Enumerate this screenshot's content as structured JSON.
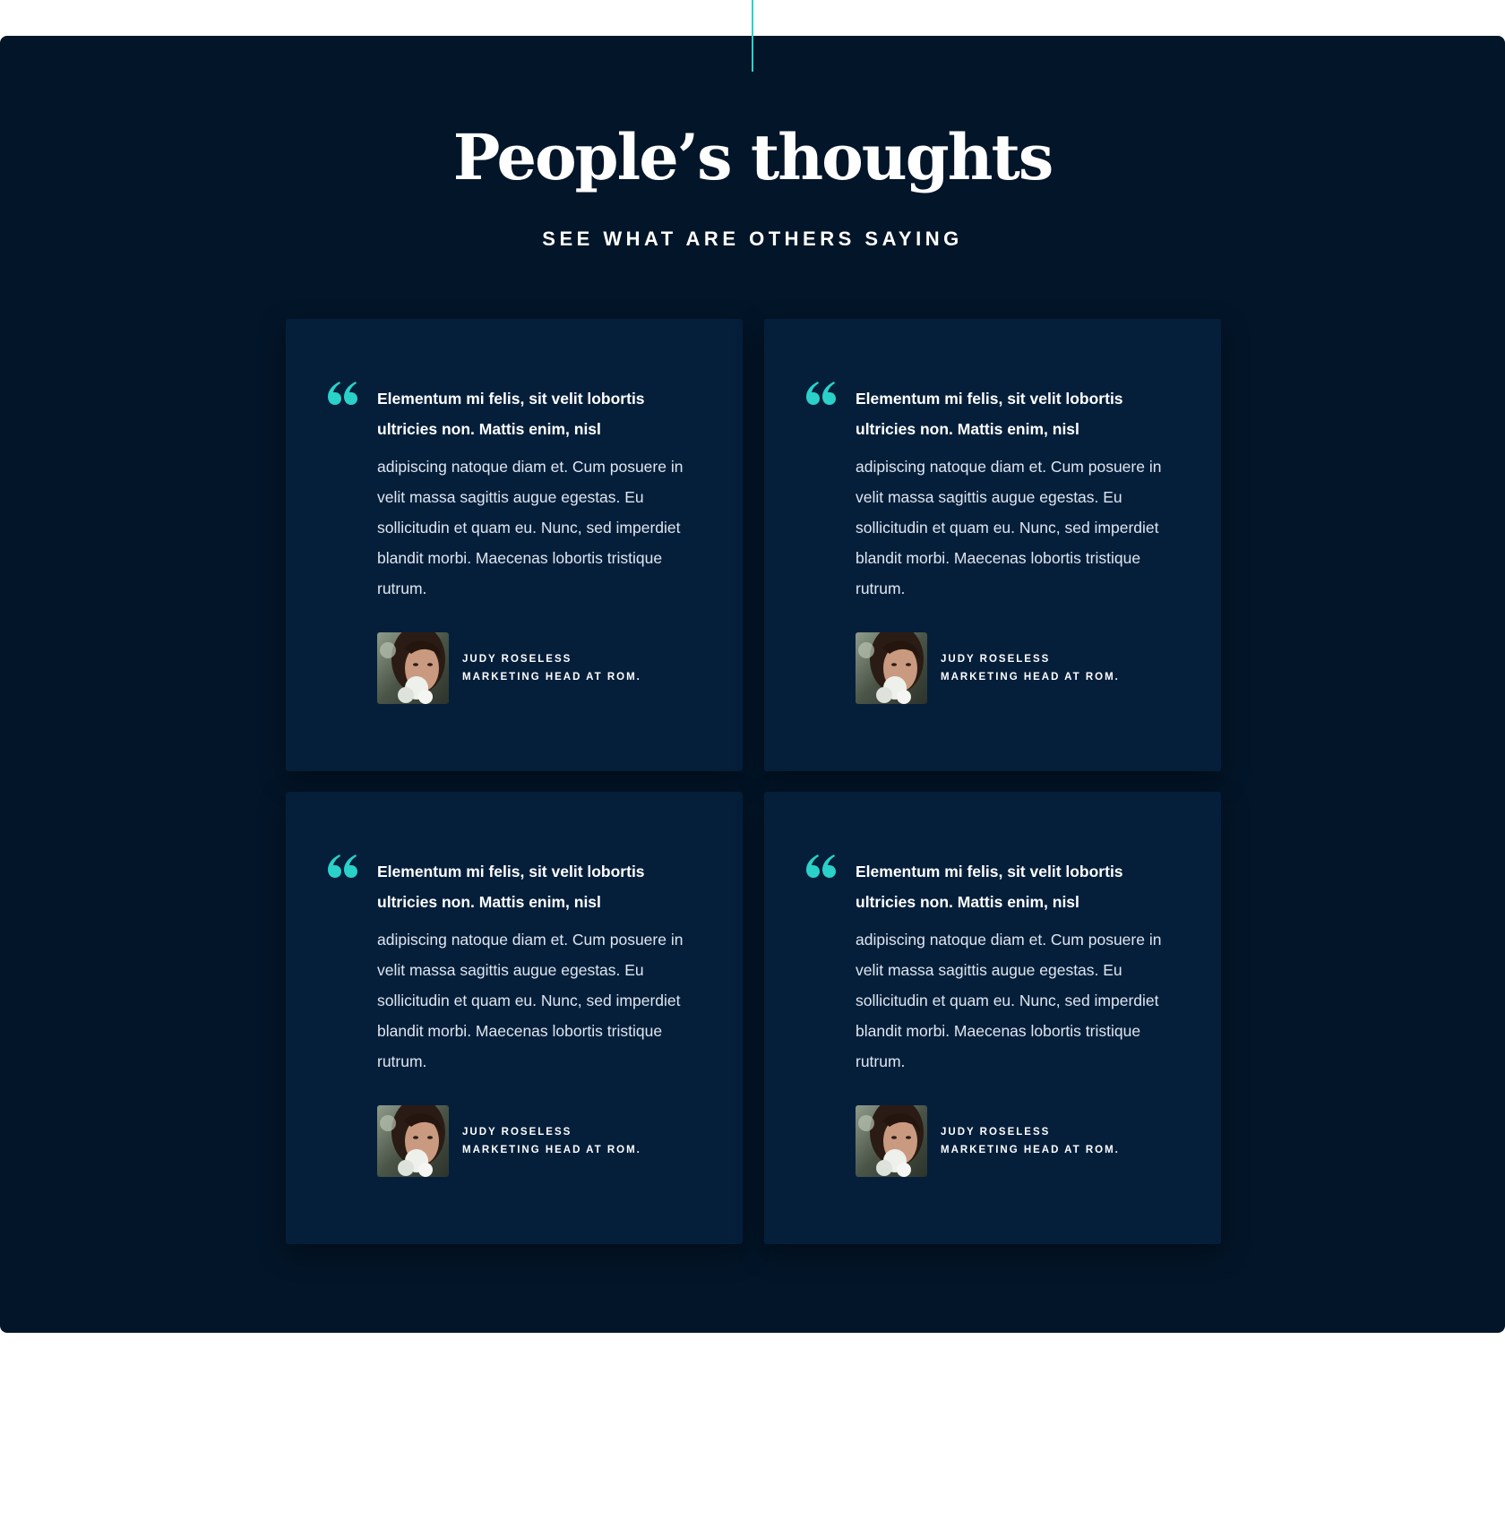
{
  "section": {
    "title": "People’s thoughts",
    "subtitle": "SEE WHAT ARE OTHERS SAYING"
  },
  "colors": {
    "background": "#031528",
    "card": "#051f3b",
    "accent": "#2ad1c9",
    "text": "#ffffff"
  },
  "testimonials": [
    {
      "icon": "quote-icon",
      "lead": "Elementum mi felis, sit velit lobortis ultricies non. Mattis enim, nisl",
      "body": "adipiscing natoque diam et. Cum posuere in velit massa sagittis augue egestas. Eu sollicitudin et quam eu. Nunc, sed imperdiet blandit morbi. Maecenas lobortis tristique rutrum.",
      "author_name": "JUDY ROSELESS",
      "author_role": "MARKETING HEAD AT ROM."
    },
    {
      "icon": "quote-icon",
      "lead": "Elementum mi felis, sit velit lobortis ultricies non. Mattis enim, nisl",
      "body": "adipiscing natoque diam et. Cum posuere in velit massa sagittis augue egestas. Eu sollicitudin et quam eu. Nunc, sed imperdiet blandit morbi. Maecenas lobortis tristique rutrum.",
      "author_name": "JUDY ROSELESS",
      "author_role": "MARKETING HEAD AT ROM."
    },
    {
      "icon": "quote-icon",
      "lead": "Elementum mi felis, sit velit lobortis ultricies non. Mattis enim, nisl",
      "body": "adipiscing natoque diam et. Cum posuere in velit massa sagittis augue egestas. Eu sollicitudin et quam eu. Nunc, sed imperdiet blandit morbi. Maecenas lobortis tristique rutrum.",
      "author_name": "JUDY ROSELESS",
      "author_role": "MARKETING HEAD AT ROM."
    },
    {
      "icon": "quote-icon",
      "lead": "Elementum mi felis, sit velit lobortis ultricies non. Mattis enim, nisl",
      "body": "adipiscing natoque diam et. Cum posuere in velit massa sagittis augue egestas. Eu sollicitudin et quam eu. Nunc, sed imperdiet blandit morbi. Maecenas lobortis tristique rutrum.",
      "author_name": "JUDY ROSELESS",
      "author_role": "MARKETING HEAD AT ROM."
    }
  ]
}
